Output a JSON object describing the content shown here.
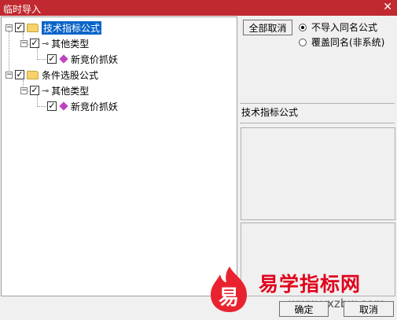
{
  "window": {
    "title": "临时导入",
    "close_glyph": "✕"
  },
  "tree": [
    {
      "label": "技术指标公式",
      "children": [
        {
          "label": "其他类型",
          "children": [
            {
              "label": "新竞价抓妖"
            }
          ]
        }
      ]
    },
    {
      "label": "条件选股公式",
      "children": [
        {
          "label": "其他类型",
          "children": [
            {
              "label": "新竞价抓妖"
            }
          ]
        }
      ]
    }
  ],
  "toolbar": {
    "cancel_all_label": "全部取消"
  },
  "options": {
    "no_import_label": "不导入同名公式",
    "overwrite_label": "覆盖同名(非系统)",
    "selected": "no_import"
  },
  "info": {
    "formula_type": "技术指标公式"
  },
  "footer": {
    "ok_label": "确定",
    "cancel_label": "取消"
  },
  "watermark": {
    "logo_char": "易",
    "text": "易学指标网",
    "url": "www.yxzbw.com"
  }
}
